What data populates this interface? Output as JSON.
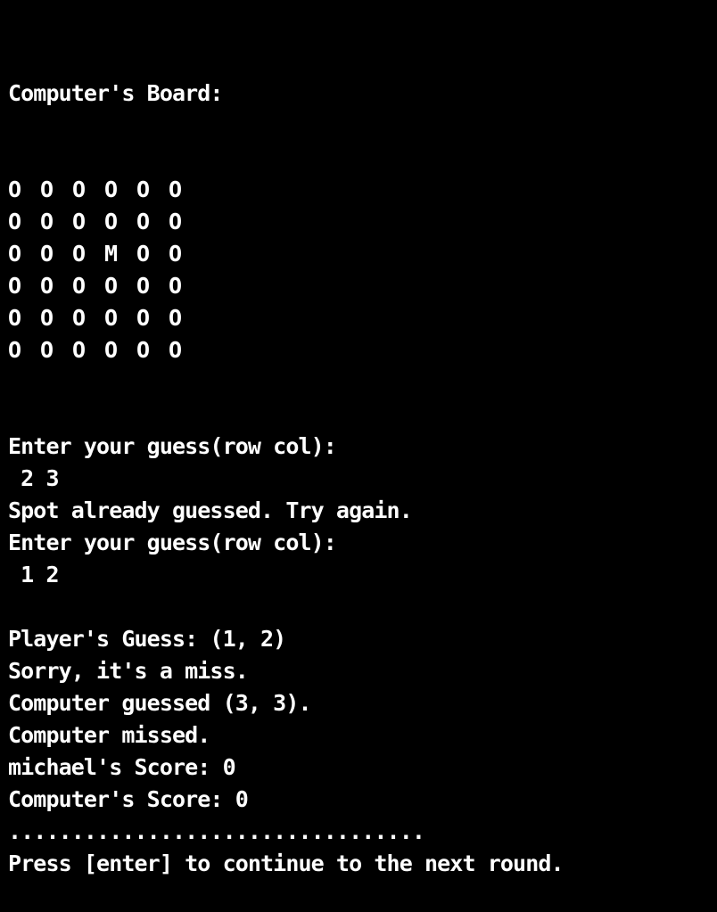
{
  "terminal": {
    "background": "#000000",
    "foreground": "#ffffff",
    "board_title": "Computer's Board:",
    "board": [
      [
        "O",
        "O",
        "O",
        "O",
        "O",
        "O"
      ],
      [
        "O",
        "O",
        "O",
        "O",
        "O",
        "O"
      ],
      [
        "O",
        "O",
        "O",
        "M",
        "O",
        "O"
      ],
      [
        "O",
        "O",
        "O",
        "O",
        "O",
        "O"
      ],
      [
        "O",
        "O",
        "O",
        "O",
        "O",
        "O"
      ],
      [
        "O",
        "O",
        "O",
        "O",
        "O",
        "O"
      ]
    ],
    "lines_after_board": [
      {
        "type": "prompt",
        "text": "Enter your guess(row col):"
      },
      {
        "type": "input",
        "text": " 2 3"
      },
      {
        "type": "output",
        "text": "Spot already guessed. Try again."
      },
      {
        "type": "prompt",
        "text": "Enter your guess(row col):"
      },
      {
        "type": "input",
        "text": " 1 2"
      },
      {
        "type": "blank",
        "text": ""
      },
      {
        "type": "output",
        "text": "Player's Guess: (1, 2)"
      },
      {
        "type": "output",
        "text": "Sorry, it's a miss."
      },
      {
        "type": "output",
        "text": "Computer guessed (3, 3)."
      },
      {
        "type": "output",
        "text": "Computer missed."
      },
      {
        "type": "output",
        "text": "michael's Score: 0"
      },
      {
        "type": "output",
        "text": "Computer's Score: 0"
      },
      {
        "type": "separator",
        "text": "................................."
      },
      {
        "type": "prompt",
        "text": "Press [enter] to continue to the next round."
      }
    ]
  }
}
